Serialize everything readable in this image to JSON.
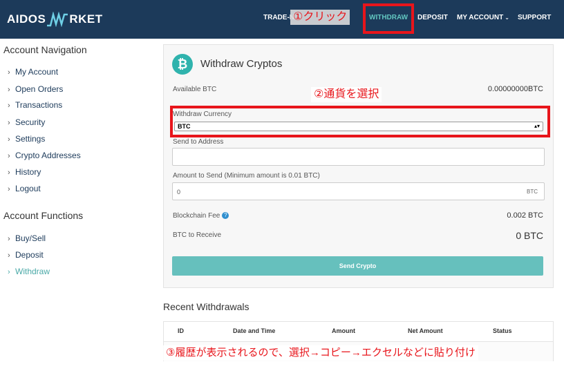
{
  "header": {
    "logo_left": "AIDOS",
    "logo_right": "RKET",
    "nav": [
      {
        "label": "TRADE-N"
      },
      {
        "label": "WITHDRAW"
      },
      {
        "label": "DEPOSIT"
      },
      {
        "label": "MY ACCOUNT"
      },
      {
        "label": "SUPPORT"
      }
    ],
    "active_color": "#62c6c0",
    "bg_color": "#1c3a5a"
  },
  "annotations": {
    "step1": "①クリック",
    "step2": "②通貨を選択",
    "step3": "③履歴が表示されるので、選択→コピー→エクセルなどに貼り付け",
    "color": "#e8151b"
  },
  "sidebar": {
    "nav_title": "Account Navigation",
    "nav_items": [
      {
        "label": "My Account"
      },
      {
        "label": "Open Orders"
      },
      {
        "label": "Transactions"
      },
      {
        "label": "Security"
      },
      {
        "label": "Settings"
      },
      {
        "label": "Crypto Addresses"
      },
      {
        "label": "History"
      },
      {
        "label": "Logout"
      }
    ],
    "functions_title": "Account Functions",
    "function_items": [
      {
        "label": "Buy/Sell"
      },
      {
        "label": "Deposit"
      },
      {
        "label": "Withdraw"
      }
    ]
  },
  "withdraw": {
    "coin_symbol": "₿",
    "title": "Withdraw Cryptos",
    "available_label": "Available BTC",
    "available_value": "0.00000000BTC",
    "currency_label": "Withdraw Currency",
    "currency_selected": "BTC",
    "address_label": "Send to Address",
    "address_value": "",
    "amount_label": "Amount to Send (Minimum amount is 0.01 BTC)",
    "amount_value": "0",
    "amount_unit": "BTC",
    "fee_label": "Blockchain Fee",
    "fee_value": "0.002 BTC",
    "receive_label": "BTC to Receive",
    "receive_value": "0 BTC",
    "send_button": "Send Crypto"
  },
  "recent": {
    "title": "Recent Withdrawals",
    "columns": [
      "ID",
      "Date and Time",
      "Amount",
      "Net Amount",
      "Status"
    ]
  }
}
